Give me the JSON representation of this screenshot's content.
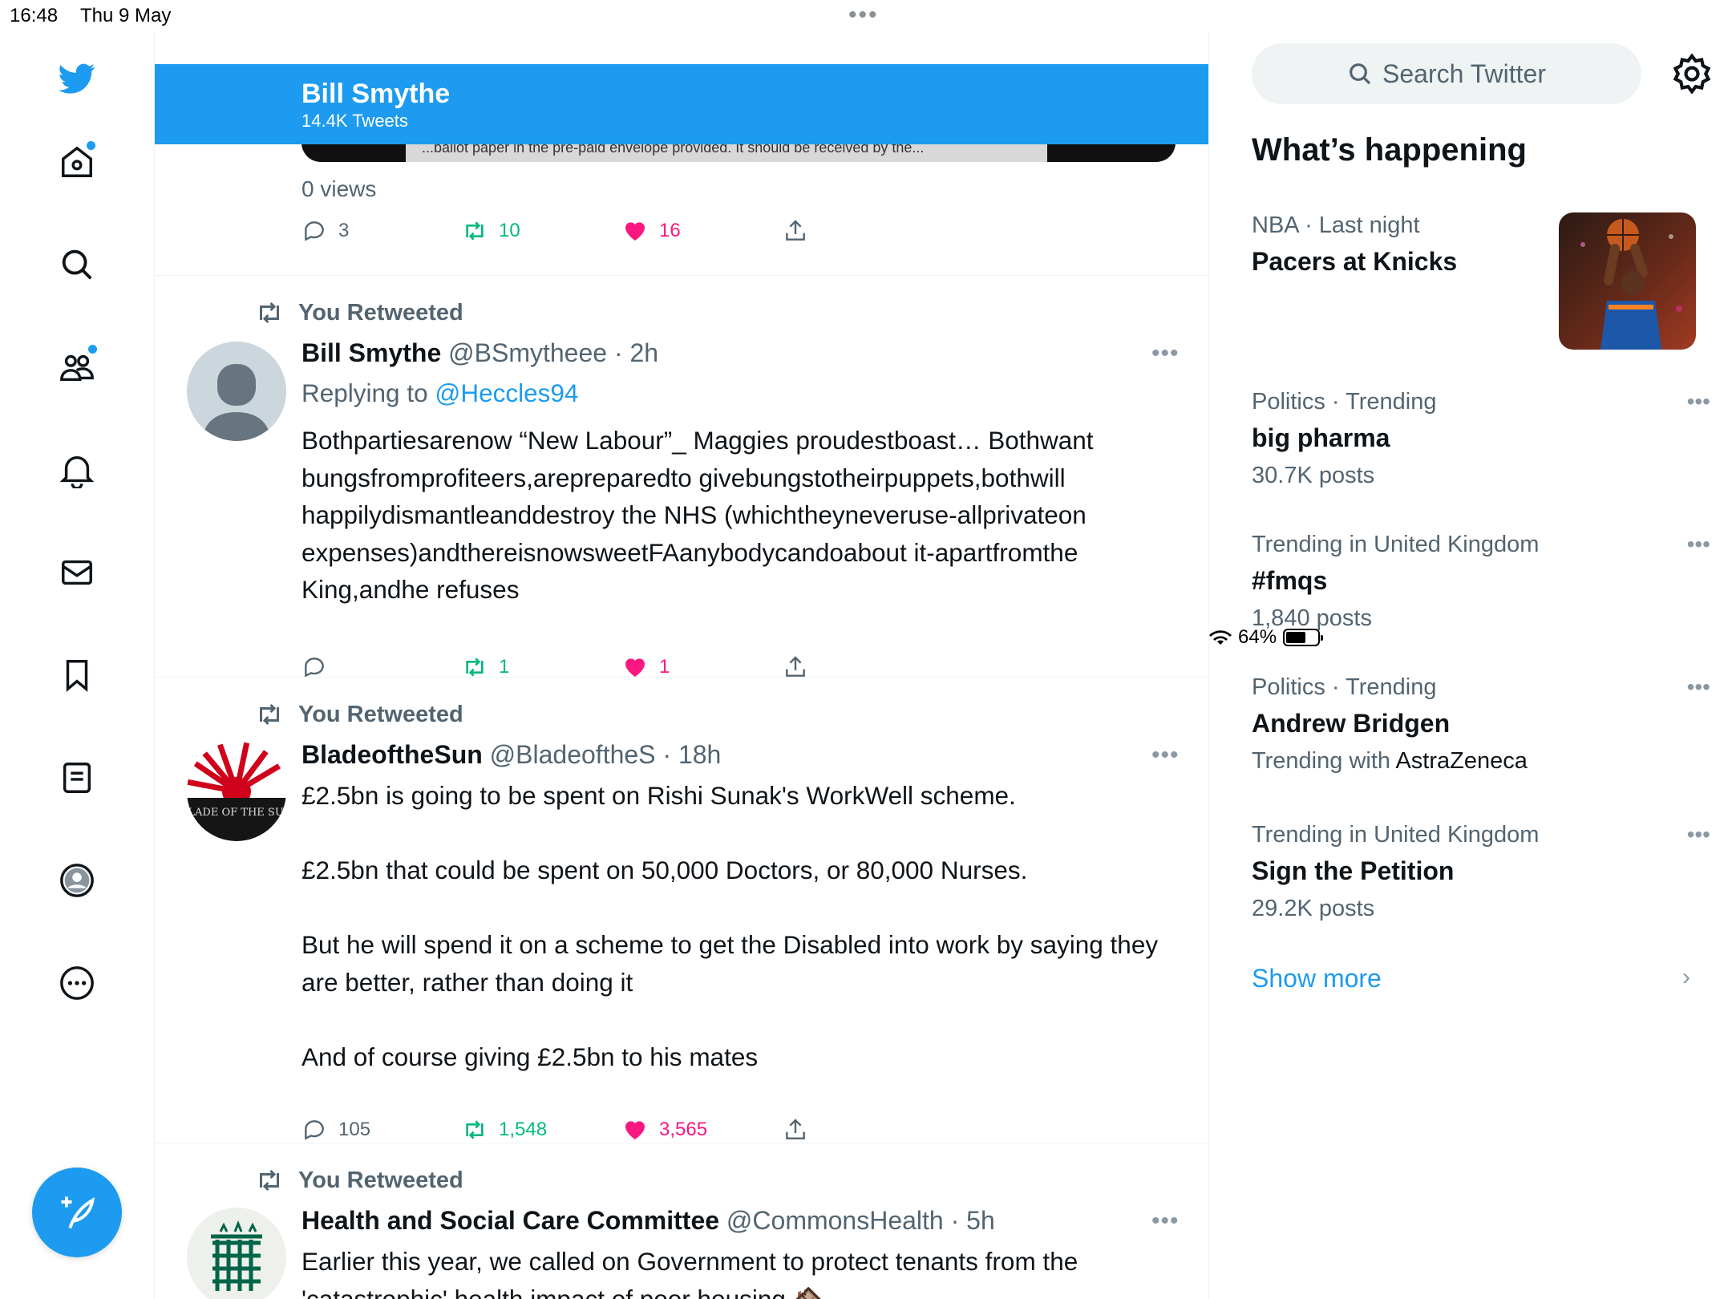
{
  "status": {
    "time": "16:48",
    "date": "Thu 9 May",
    "battery": "64%",
    "battery_level": 0.64
  },
  "header": {
    "name": "Bill Smythe",
    "tweets": "14.4K Tweets"
  },
  "top_tweet": {
    "media_text": "...ballot paper in the pre-paid envelope provided. It should be received by the...",
    "views": "0 views",
    "replies": "3",
    "retweets": "10",
    "likes": "16"
  },
  "tweets": [
    {
      "retweeted_label": "You Retweeted",
      "name": "Bill Smythe",
      "handle": "@BSmytheee",
      "time": "· 2h",
      "replying_prefix": "Replying to",
      "replying_to": "@Heccles94",
      "body": "Bothpartiesarenow “New Labour”_ Maggies proudestboast… Bothwant bungsfromprofiteers,arepreparedto givebungstotheirpuppets,bothwill happilydismantleanddestroy the NHS (whichtheyneveruse-allprivateon expenses)andthereisnowsweetFAanybodycandoabout it-apartfromthe King,andhe refuses",
      "replies": "",
      "retweets": "1",
      "likes": "1"
    },
    {
      "retweeted_label": "You Retweeted",
      "name": "BladeoftheSun",
      "handle": "@BladeoftheS",
      "time": "· 18h",
      "avatar_text": "BLADE OF THE SUN",
      "body": "£2.5bn is going to be spent on Rishi Sunak's WorkWell scheme.\n\n£2.5bn that could be spent on 50,000 Doctors, or 80,000 Nurses.\n\nBut he will spend it on a scheme to get the Disabled into work by saying they are better, rather than doing it\n\nAnd of course giving £2.5bn to his mates",
      "replies": "105",
      "retweets": "1,548",
      "likes": "3,565"
    },
    {
      "retweeted_label": "You Retweeted",
      "name": "Health and Social Care Committee",
      "handle": "@CommonsHealth",
      "time": "· 5h",
      "body": "Earlier this year, we called on Government to protect tenants from the 'catastrophic' health impact of poor housing 🏚️"
    }
  ],
  "sidebar": {
    "search_placeholder": "Search Twitter",
    "title": "What’s happening",
    "trends": [
      {
        "meta": "NBA · Last night",
        "title": "Pacers at Knicks",
        "sub": ""
      },
      {
        "meta": "Politics · Trending",
        "title": "big pharma",
        "sub": "30.7K posts"
      },
      {
        "meta": "Trending in United Kingdom",
        "title": "#fmqs",
        "sub": "1,840 posts"
      },
      {
        "meta": "Politics · Trending",
        "title": "Andrew Bridgen",
        "sub_prefix": "Trending with ",
        "sub_bold": "AstraZeneca"
      },
      {
        "meta": "Trending in United Kingdom",
        "title": "Sign the Petition",
        "sub": "29.2K posts"
      }
    ],
    "show_more": "Show more"
  },
  "colors": {
    "accent": "#1d9bf0",
    "retweet": "#00ba7c",
    "like": "#f91880",
    "muted": "#536471"
  },
  "icons": [
    "twitter-bird-icon",
    "home-icon",
    "search-icon",
    "communities-icon",
    "bell-icon",
    "mail-icon",
    "bookmark-icon",
    "lists-icon",
    "profile-icon",
    "more-icon",
    "compose-icon"
  ]
}
